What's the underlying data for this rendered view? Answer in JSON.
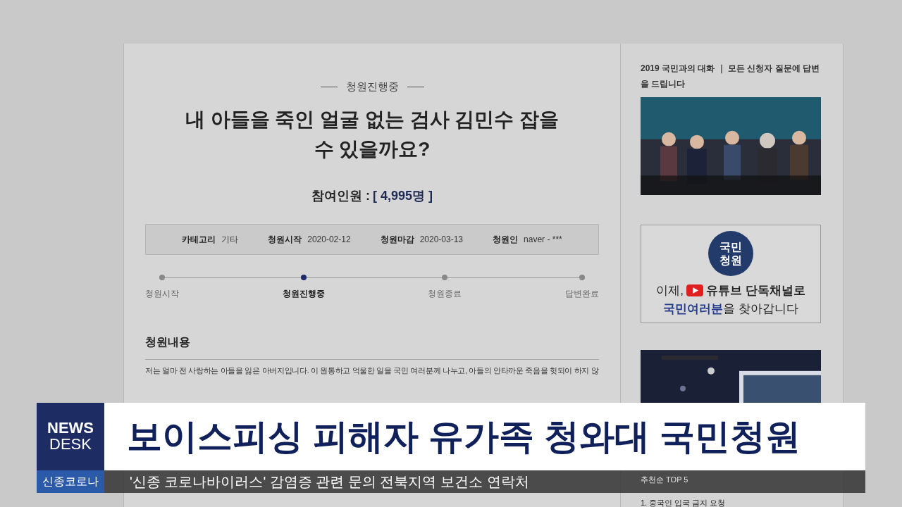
{
  "petition": {
    "status": "청원진행중",
    "title": "내 아들을 죽인 얼굴 없는 검사 김민수 잡을 수 있을까요?",
    "participants_label": "참여인원 :",
    "participants_count": "[ 4,995명 ]",
    "meta": [
      {
        "label": "카테고리",
        "value": "기타"
      },
      {
        "label": "청원시작",
        "value": "2020-02-12"
      },
      {
        "label": "청원마감",
        "value": "2020-03-13"
      },
      {
        "label": "청원인",
        "value": "naver - ***"
      }
    ],
    "steps": [
      {
        "label": "청원시작",
        "selected": false
      },
      {
        "label": "청원진행중",
        "selected": true
      },
      {
        "label": "청원종료",
        "selected": false
      },
      {
        "label": "답변완료",
        "selected": false
      }
    ],
    "content_heading": "청원내용",
    "content_text": "저는 얼마 전 사랑하는 아들을 잃은 아버지입니다. 이 원통하고 억울한 일을 국민 여러분께 나누고, 아들의 안타까운 죽음을 헛되이 하지 않"
  },
  "sidebar": {
    "video_title": "2019 국민과의 대화 ｜ 모든 신청자 질문에 답변을 드립니다",
    "banner": {
      "badge": "국민청원",
      "line1_start": "이제,",
      "line1_end": "유튜브 단독채널로",
      "line2_strong": "국민여러분",
      "line2_end": "을 찾아갑니다"
    },
    "top_heading": "추천순 TOP 5",
    "top_items": [
      "1. 중국인 입국 금지 요청"
    ]
  },
  "broadcast": {
    "logo_top": "NEWS",
    "logo_bottom": "DESK",
    "section": "신종코로나",
    "headline": "보이스피싱 피해자 유가족 청와대 국민청원",
    "ticker": "'신종 코로나바이러스' 감염증 관련 문의 전북지역 보건소 연락처"
  }
}
